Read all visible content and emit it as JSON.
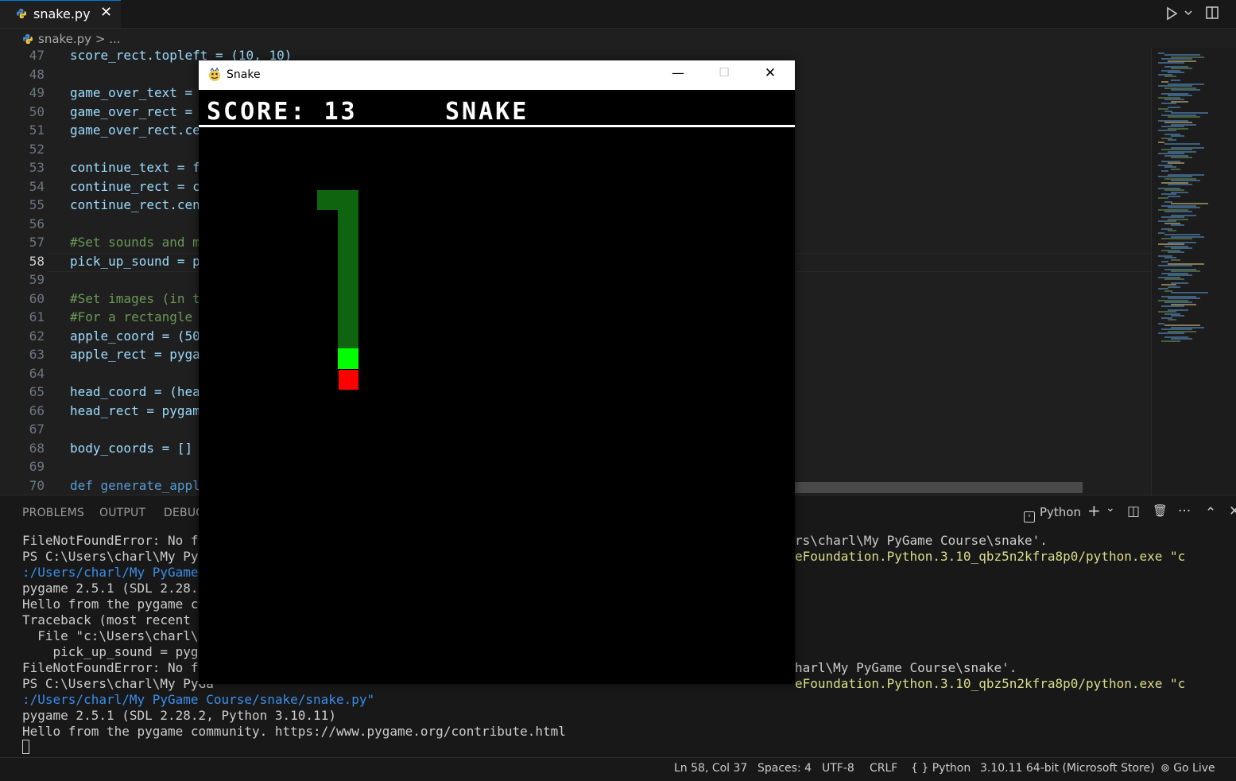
{
  "editor_tab": {
    "filename": "snake.py",
    "close_glyph": "✕"
  },
  "breadcrumb": {
    "file": "snake.py",
    "separator": ">",
    "more": "..."
  },
  "code_lines": [
    {
      "n": "47",
      "text": "score_rect.topleft = (10, 10)",
      "kind": "code"
    },
    {
      "n": "48",
      "text": "",
      "kind": "code"
    },
    {
      "n": "49",
      "text": "game_over_text = ",
      "kind": "code"
    },
    {
      "n": "50",
      "text": "game_over_rect = ",
      "kind": "code"
    },
    {
      "n": "51",
      "text": "game_over_rect.ce",
      "kind": "code"
    },
    {
      "n": "52",
      "text": "",
      "kind": "code"
    },
    {
      "n": "53",
      "text": "continue_text = f",
      "kind": "code"
    },
    {
      "n": "54",
      "text": "continue_rect = c",
      "kind": "code"
    },
    {
      "n": "55",
      "text": "continue_rect.cen",
      "kind": "code"
    },
    {
      "n": "56",
      "text": "",
      "kind": "code"
    },
    {
      "n": "57",
      "text": "#Set sounds and m",
      "kind": "comment"
    },
    {
      "n": "58",
      "text": "pick_up_sound = p",
      "kind": "code",
      "current": true
    },
    {
      "n": "59",
      "text": "",
      "kind": "code"
    },
    {
      "n": "60",
      "text": "#Set images (in t",
      "kind": "comment"
    },
    {
      "n": "61",
      "text": "#For a rectangle ",
      "kind": "comment"
    },
    {
      "n": "62",
      "text": "apple_coord = (50",
      "kind": "code"
    },
    {
      "n": "63",
      "text": "apple_rect = pyga",
      "kind": "code"
    },
    {
      "n": "64",
      "text": "",
      "kind": "code"
    },
    {
      "n": "65",
      "text": "head_coord = (hea",
      "kind": "code"
    },
    {
      "n": "66",
      "text": "head_rect = pygam",
      "kind": "code"
    },
    {
      "n": "67",
      "text": "",
      "kind": "code"
    },
    {
      "n": "68",
      "text": "body_coords = []",
      "kind": "code"
    },
    {
      "n": "69",
      "text": "",
      "kind": "code"
    },
    {
      "n": "70",
      "text": "def generate_appl",
      "kind": "kw"
    }
  ],
  "panel": {
    "tabs": [
      "PROBLEMS",
      "OUTPUT",
      "DEBUG"
    ],
    "terminal_profile": "Python",
    "controls": {
      "add": "+",
      "chevron": "⌄",
      "split": "◫",
      "trash": "🗑",
      "more": "···",
      "maximize": "⌃",
      "close": "✕"
    }
  },
  "terminal_lines": [
    {
      "left": "FileNotFoundError: No fil",
      "right": "rs\\charl\\My PyGame Course\\snake'."
    },
    {
      "left": "PS C:\\Users\\charl\\My PyGa",
      "right": "eFoundation.Python.3.10_qbz5n2kfra8p0/python.exe \"c",
      "right_kind": "y"
    },
    {
      "left": ":/Users/charl/My PyGame C",
      "right": "",
      "left_kind": "link"
    },
    {
      "left": "pygame 2.5.1 (SDL 2.28.2,",
      "right": ""
    },
    {
      "left": "Hello from the pygame com",
      "right": ""
    },
    {
      "left": "Traceback (most recent ca",
      "right": ""
    },
    {
      "left": "  File \"c:\\Users\\charl\\My",
      "right": ""
    },
    {
      "left": "    pick_up_sound = pygam",
      "right": ""
    },
    {
      "left": "FileNotFoundError: No fil",
      "right": "harl\\My PyGame Course\\snake'."
    },
    {
      "left": "PS C:\\Users\\charl\\My PyGa",
      "right": "eFoundation.Python.3.10_qbz5n2kfra8p0/python.exe \"c",
      "right_kind": "y"
    },
    {
      "left": ":/Users/charl/My PyGame Course/snake/snake.py\"",
      "right": "",
      "left_kind": "link"
    },
    {
      "left": "pygame 2.5.1 (SDL 2.28.2, Python 3.10.11)",
      "right": ""
    },
    {
      "left": "Hello from the pygame community. https://www.pygame.org/contribute.html",
      "right": ""
    }
  ],
  "statusbar": {
    "position": "Ln 58, Col 37",
    "spaces": "Spaces: 4",
    "encoding": "UTF-8",
    "eol": "CRLF",
    "language": "Python",
    "interpreter": "3.10.11 64-bit (Microsoft Store)",
    "golive": "Go Live"
  },
  "game_window": {
    "title": "Snake",
    "minimize": "—",
    "maximize": "☐",
    "close": "✕",
    "score_label": "SCORE:",
    "score": 13,
    "game_title": "SNAKE",
    "colors": {
      "body": "#0f640f",
      "head": "#00ff00",
      "apple": "#ff0000"
    }
  }
}
